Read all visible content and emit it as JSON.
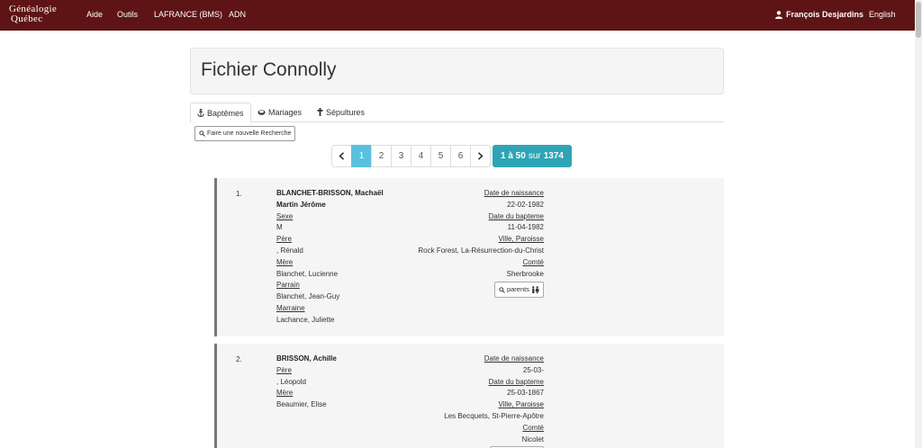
{
  "nav": {
    "logo_line1": "Généalogie",
    "logo_line2": "Québec",
    "items": [
      "Aide",
      "Outils",
      "LAFRANCE (BMS)",
      "ADN"
    ],
    "user": "François Desjardins",
    "language": "English"
  },
  "header": {
    "title": "Fichier Connolly"
  },
  "tabs": [
    {
      "label": "Baptêmes",
      "icon": "anchor-icon",
      "active": true
    },
    {
      "label": "Mariages",
      "icon": "rings-icon",
      "active": false
    },
    {
      "label": "Sépultures",
      "icon": "cross-icon",
      "active": false
    }
  ],
  "search_button": "Faire une nouvelle Recherche",
  "pagination": {
    "pages": [
      "1",
      "2",
      "3",
      "4",
      "5",
      "6"
    ],
    "current": "1",
    "info_range": "1 à 50",
    "info_sur": "sur",
    "info_total": "1374"
  },
  "records": [
    {
      "num": "1.",
      "name_line1": "BLANCHET-BRISSON, Machaël",
      "name_line2": "Martin Jérôme",
      "sexe_label": "Sexe",
      "sexe": "M",
      "pere_label": "Père",
      "pere": ", Rénald",
      "mere_label": "Mère",
      "mere": "Blanchet, Lucienne",
      "parrain_label": "Parrain",
      "parrain": "Blanchet, Jean-Guy",
      "marraine_label": "Marraine",
      "marraine": "Lachance, Juliette",
      "naissance_label": "Date de naissance",
      "naissance": "22-02-1982",
      "bapteme_label": "Date du bapteme",
      "bapteme": "11-04-1982",
      "paroisse_label": "Ville, Paroisse",
      "paroisse": "Rock Forest, La-Résurrection-du-Christ",
      "comte_label": "Comté",
      "comte": "Sherbrooke",
      "parents_button": "parents"
    },
    {
      "num": "2.",
      "name_line1": "BRISSON, Achille",
      "pere_label": "Père",
      "pere": ", Léopold",
      "mere_label": "Mère",
      "mere": "Beaumier, Elise",
      "naissance_label": "Date de naissance",
      "naissance": "25-03-",
      "bapteme_label": "Date du bapteme",
      "bapteme": "25-03-1867",
      "paroisse_label": "Ville, Paroisse",
      "paroisse": "Les Becquets, St-Pierre-Apôtre",
      "comte_label": "Comté",
      "comte": "Nicolet"
    }
  ]
}
